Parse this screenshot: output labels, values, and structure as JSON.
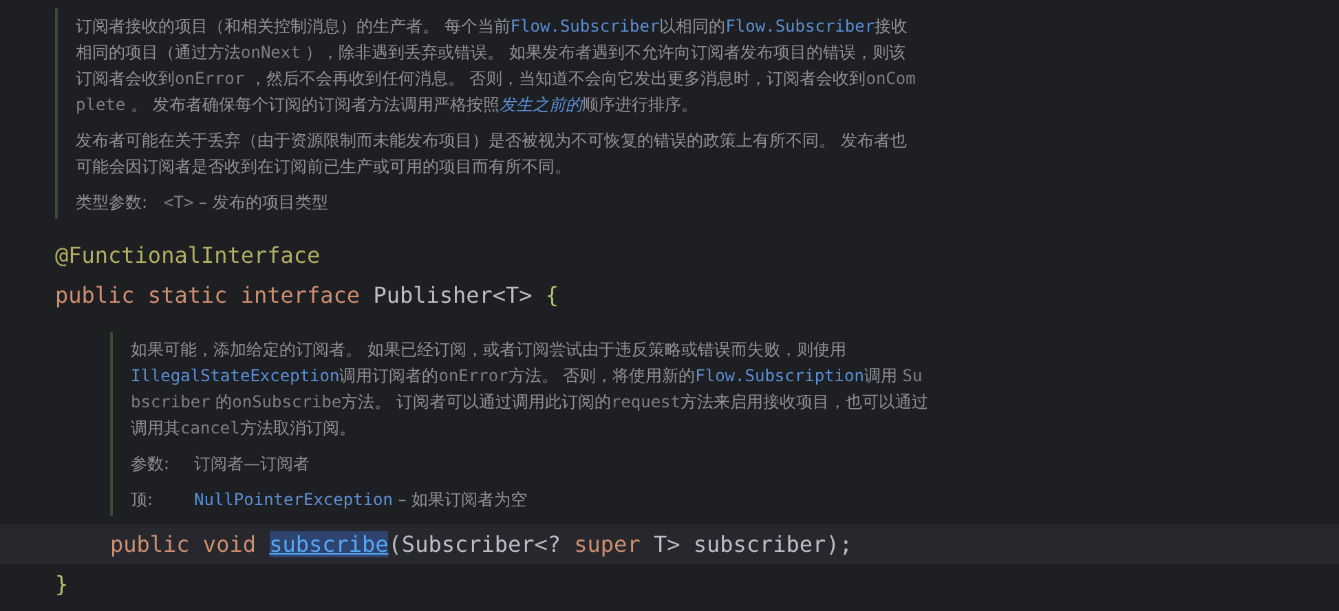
{
  "blocks": [
    {
      "kind": "doc",
      "indented": false,
      "paragraphs": [
        [
          {
            "kind": "text",
            "text": "订阅者接收的项目（和相关控制消息）的生产者。 每个当前"
          },
          {
            "kind": "link",
            "text": "Flow.Subscriber"
          },
          {
            "kind": "text",
            "text": "以相同的"
          },
          {
            "kind": "link",
            "text": "Flow.Subscriber"
          },
          {
            "kind": "text",
            "text": "接收相同的项目（通过方法"
          },
          {
            "kind": "code",
            "text": "onNext"
          },
          {
            "kind": "text",
            "text": " ），除非遇到丢弃或错误。 如果发布者遇到不允许向订阅者发布项目的错误，则该订阅者会收到"
          },
          {
            "kind": "code",
            "text": "onError"
          },
          {
            "kind": "text",
            "text": " ，然后不会再收到任何消息。 否则，当知道不会向它发出更多消息时，订阅者会收到"
          },
          {
            "kind": "code",
            "text": "onComplete"
          },
          {
            "kind": "text",
            "text": " 。 发布者确保每个订阅的订阅者方法调用严格按照"
          },
          {
            "kind": "italic-link",
            "text": "发生之前的"
          },
          {
            "kind": "text",
            "text": "顺序进行排序。"
          }
        ],
        [
          {
            "kind": "text",
            "text": "发布者可能在关于丢弃（由于资源限制而未能发布项目）是否被视为不可恢复的错误的政策上有所不同。 发布者也可能会因订阅者是否收到在订阅前已生产或可用的项目而有所不同。"
          }
        ]
      ],
      "tags": [
        {
          "label": "类型参数:",
          "segments": [
            {
              "kind": "code",
              "text": "<T>"
            },
            {
              "kind": "text",
              "text": " – 发布的项目类型"
            }
          ]
        }
      ]
    },
    {
      "kind": "code",
      "indented": false,
      "current": false,
      "tokens": [
        {
          "kind": "annotation",
          "text": "@FunctionalInterface"
        }
      ]
    },
    {
      "kind": "code",
      "indented": false,
      "current": false,
      "tokens": [
        {
          "kind": "keyword",
          "text": "public static interface"
        },
        {
          "kind": "plain",
          "text": " Publisher<T> "
        },
        {
          "kind": "brace",
          "text": "{"
        }
      ]
    },
    {
      "kind": "doc",
      "indented": true,
      "paragraphs": [
        [
          {
            "kind": "text",
            "text": "如果可能，添加给定的订阅者。 如果已经订阅，或者订阅尝试由于违反策略或错误而失败，则使用"
          },
          {
            "kind": "link",
            "text": "IllegalStateException"
          },
          {
            "kind": "text",
            "text": "调用订阅者的"
          },
          {
            "kind": "code",
            "text": "onError"
          },
          {
            "kind": "text",
            "text": "方法。 否则，将使用新的"
          },
          {
            "kind": "link",
            "text": "Flow.Subscription"
          },
          {
            "kind": "text",
            "text": "调用 "
          },
          {
            "kind": "code",
            "text": "Subscriber"
          },
          {
            "kind": "text",
            "text": " 的"
          },
          {
            "kind": "code",
            "text": "onSubscribe"
          },
          {
            "kind": "text",
            "text": "方法。 订阅者可以通过调用此订阅的"
          },
          {
            "kind": "code",
            "text": "request"
          },
          {
            "kind": "text",
            "text": "方法来启用接收项目，也可以通过调用其"
          },
          {
            "kind": "code",
            "text": "cancel"
          },
          {
            "kind": "text",
            "text": "方法取消订阅。"
          }
        ]
      ],
      "tags": [
        {
          "label": "参数:",
          "segments": [
            {
              "kind": "text",
              "text": "订阅者—订阅者"
            }
          ]
        },
        {
          "label": "顶:",
          "segments": [
            {
              "kind": "link",
              "text": "NullPointerException"
            },
            {
              "kind": "text",
              "text": " – 如果订阅者为空"
            }
          ]
        }
      ]
    },
    {
      "kind": "code",
      "indented": true,
      "current": true,
      "tokens": [
        {
          "kind": "keyword",
          "text": "public void "
        },
        {
          "kind": "method",
          "text": "subscribe",
          "highlighted": true
        },
        {
          "kind": "plain",
          "text": "(Subscriber<? "
        },
        {
          "kind": "keyword",
          "text": "super"
        },
        {
          "kind": "plain",
          "text": " T> subscriber);"
        }
      ]
    },
    {
      "kind": "code",
      "indented": false,
      "current": false,
      "tokens": [
        {
          "kind": "brace",
          "text": "}"
        }
      ]
    }
  ]
}
